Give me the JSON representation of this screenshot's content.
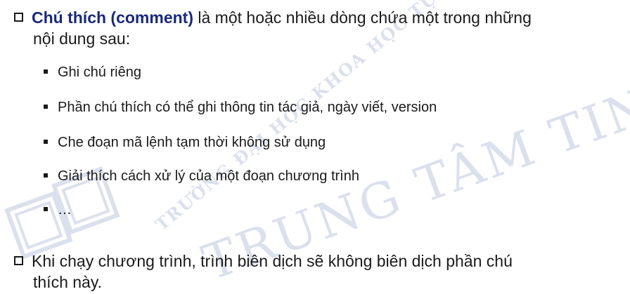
{
  "bullet1": {
    "bold": "Chú thích (comment)",
    "rest_line1": " là một hoặc nhiều dòng chứa một trong những",
    "rest_line2": "nội dung sau:"
  },
  "sub_items": [
    "Ghi chú riêng",
    "Phần chú thích có thể ghi thông tin tác giả, ngày viết, version",
    "Che đoạn mã lệnh tạm thời không sử dụng",
    "Giải thích cách xử lý của một đoạn chương trình",
    "…"
  ],
  "bullet2": {
    "line1": "Khi chạy chương trình, trình biên dịch sẽ không biên dịch phần chú",
    "line2": "thích này."
  },
  "watermark": {
    "arc_text": "TRƯỜNG ĐẠI HỌC KHOA HỌC TỰ NHIÊN",
    "big_text": "TRUNG TÂM TIN HỌC"
  }
}
